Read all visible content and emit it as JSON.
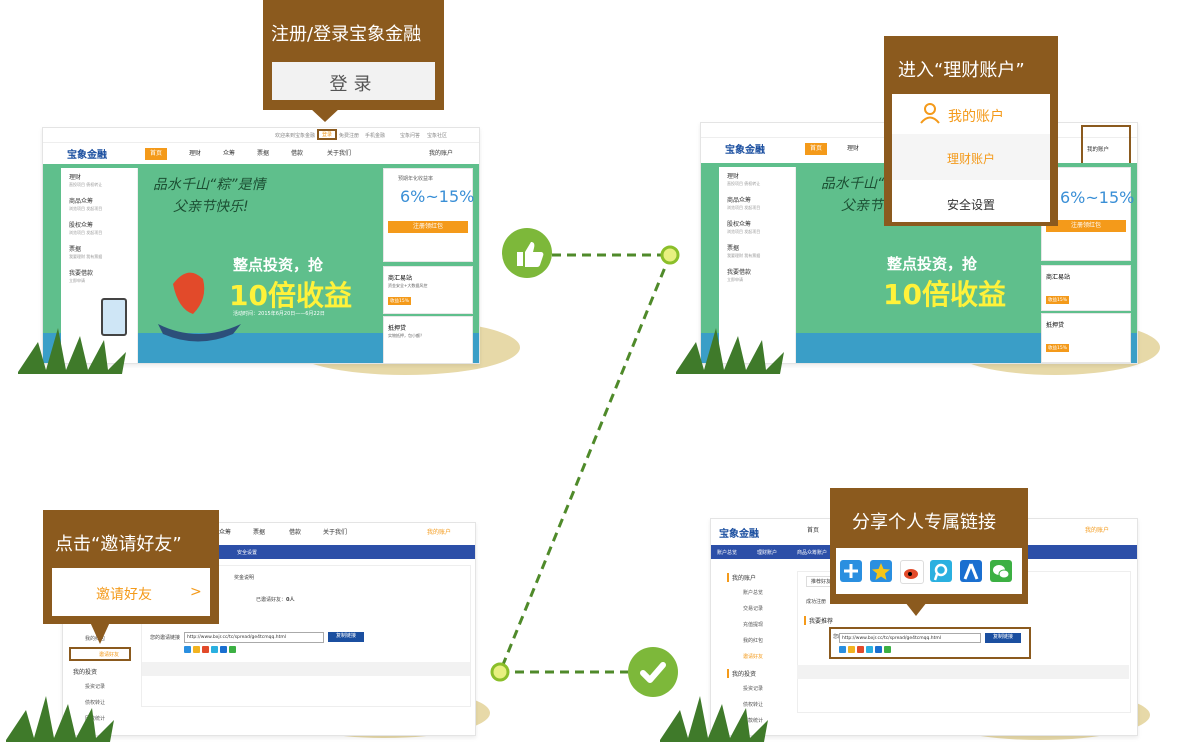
{
  "step1": {
    "callout_title": "注册/登录宝象金融",
    "callout_button": "登录",
    "topbar": {
      "welcome": "欢迎来到宝象金融",
      "login": "登录",
      "register": "免费注册",
      "mobile": "手机金融",
      "guide": "宝象问答",
      "community": "宝象社区"
    },
    "logo": "宝象金融",
    "nav": [
      "首页",
      "理财",
      "众筹",
      "票据",
      "借款",
      "关于我们"
    ],
    "my_account": "我的账户",
    "sidebar": [
      {
        "title": "理财",
        "sub": "直投项目 债权转让"
      },
      {
        "title": "商品众筹",
        "sub": "浏览项目 发起项目"
      },
      {
        "title": "股权众筹",
        "sub": "浏览项目 发起项目"
      },
      {
        "title": "票据",
        "sub": "我要理财 我有票据"
      },
      {
        "title": "我要借款",
        "sub": "立即申请"
      }
    ],
    "banner_slogan1": "品水千山“粽”是情",
    "banner_slogan2": "父亲节快乐!",
    "banner_headline1": "整点投资，抢",
    "banner_headline2": "10倍收益",
    "banner_date": "活动时间：2015年6月20日——6月22日",
    "rate_label": "预期年化收益率",
    "rate_value": "6%~15%",
    "red_packet": "注册领红包",
    "cards": [
      {
        "title": "商汇易站",
        "sub": "资金安全+大数据风控",
        "tag": "收益15%"
      },
      {
        "title": "抵押贷",
        "sub": "实物抵押，包小额？",
        "tag": "收益15%"
      }
    ]
  },
  "step2": {
    "callout_title": "进入“理财账户”",
    "menu": [
      "我的账户",
      "理财账户",
      "安全设置"
    ],
    "nav": [
      "首页",
      "理财"
    ],
    "my_account": "我的账户",
    "rate_value": "6%~15%",
    "red_packet": "注册领红包",
    "banner_headline2": "10倍收益"
  },
  "step3": {
    "callout_title": "点击“邀请好友”",
    "callout_button": "邀请好友",
    "callout_arrow": ">",
    "nav": [
      "众筹",
      "票据",
      "借款",
      "关于我们"
    ],
    "my_account": "我的账户",
    "bluebar_item": "安全设置",
    "sidebar_items": [
      "我的红包",
      "邀请好友",
      "我的投资",
      "投资记录",
      "债权转让",
      "回款统计"
    ],
    "invite_label": "您的邀请链接",
    "invite_url": "http://www.bxjr.cc/tc/spread/ge4tcmqq.html",
    "copy_button": "复制链接",
    "reward_label": "奖金说明",
    "count_label": "已邀请好友：",
    "count_value": "0人"
  },
  "step4": {
    "callout_title": "分享个人专属链接",
    "logo": "宝象金融",
    "nav": [
      "首页"
    ],
    "my_account": "我的账户",
    "bluebar_items": [
      "账户总览",
      "理财账户",
      "商品众筹账户"
    ],
    "sidebar_items": [
      "我的账户",
      "账户总览",
      "交易记录",
      "充值提现",
      "我的红包",
      "邀请好友",
      "我的投资",
      "投资记录",
      "债权转让",
      "回款统计"
    ],
    "invite_label": "您的邀请链接",
    "invite_url": "http://www.bxjr.cc/tc/spread/ge4tcmqq.html",
    "copy_button": "复制链接",
    "tab_label": "推荐好友",
    "recommend_label": "我要推荐",
    "success_label": "成功注册",
    "share_icons": [
      "plus-share-icon",
      "qzone-star-icon",
      "weibo-icon",
      "tencent-weibo-icon",
      "renren-icon",
      "wechat-icon"
    ]
  },
  "colors": {
    "brown": "#8b5a1e",
    "orange": "#f49a1a",
    "green": "#5fbf8c",
    "blue": "#2c4fa8",
    "dash_green": "#4f8a2a"
  }
}
